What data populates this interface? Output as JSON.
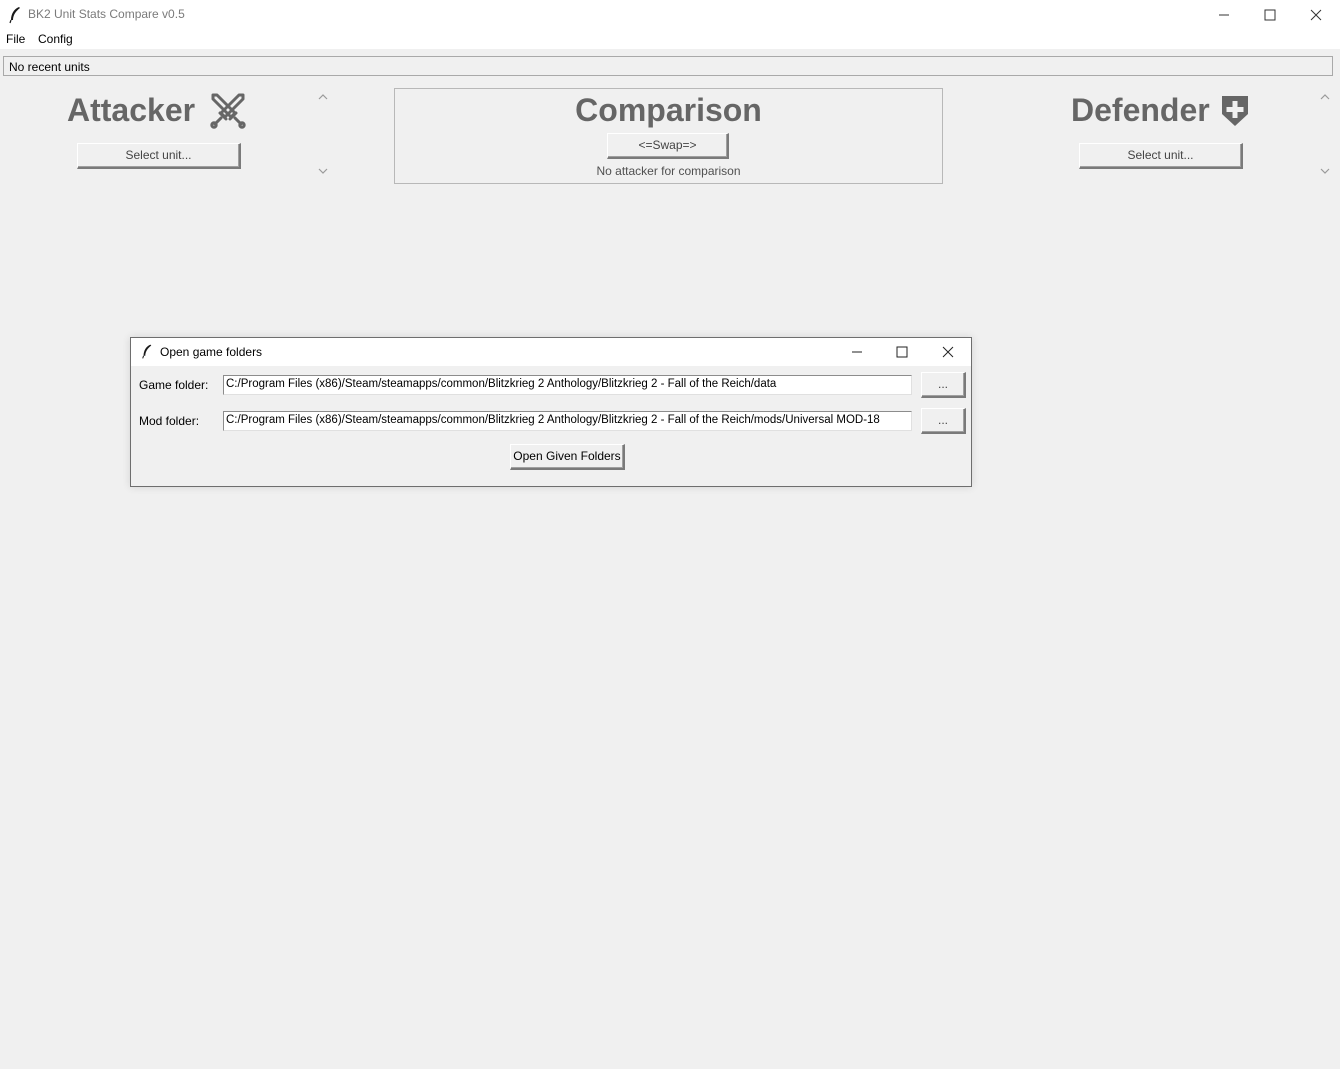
{
  "window": {
    "title": "BK2 Unit Stats Compare v0.5",
    "icons": [
      "feather-icon",
      "minimize-icon",
      "maximize-icon",
      "close-icon"
    ]
  },
  "menu": {
    "file": "File",
    "config": "Config"
  },
  "recent": {
    "label": "No recent units"
  },
  "attacker": {
    "title": "Attacker",
    "icon": "crossed-swords-icon",
    "select_label": "Select unit..."
  },
  "comparison": {
    "title": "Comparison",
    "swap_label": "<=Swap=>",
    "status": "No attacker for comparison"
  },
  "defender": {
    "title": "Defender",
    "icon": "shield-plus-icon",
    "select_label": "Select unit..."
  },
  "dialog": {
    "title": "Open game folders",
    "game_folder_label": "Game folder:",
    "game_folder_value": "C:/Program Files (x86)/Steam/steamapps/common/Blitzkrieg 2 Anthology/Blitzkrieg 2 - Fall of the Reich/data",
    "mod_folder_label": "Mod folder:",
    "mod_folder_value": "C:/Program Files (x86)/Steam/steamapps/common/Blitzkrieg 2 Anthology/Blitzkrieg 2 - Fall of the Reich/mods/Universal MOD-18",
    "browse_label": "...",
    "open_label": "Open Given Folders"
  }
}
